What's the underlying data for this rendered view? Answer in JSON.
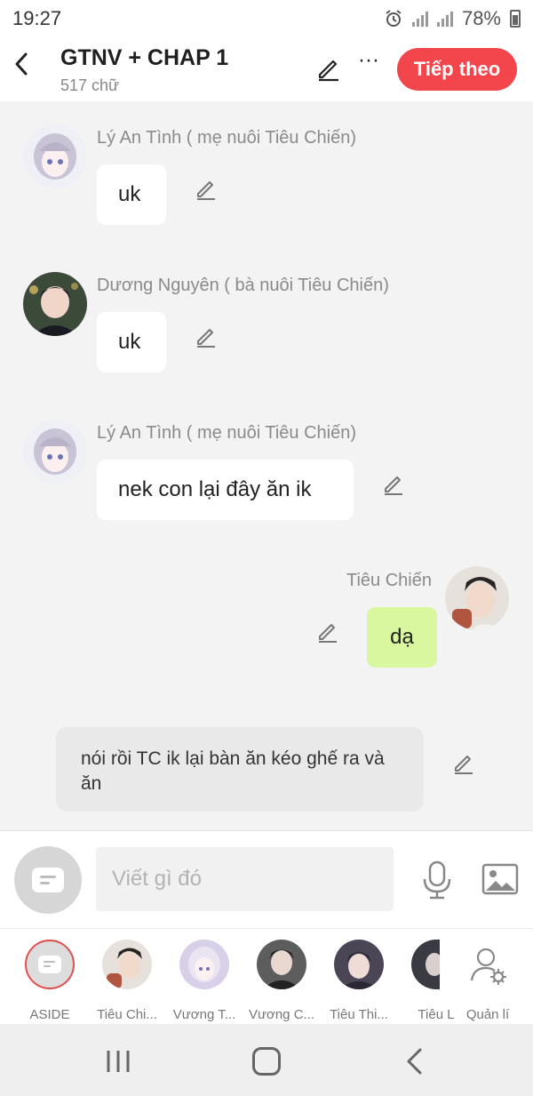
{
  "status_bar": {
    "time": "19:27",
    "battery": "78%"
  },
  "header": {
    "title": "GTNV + CHAP 1",
    "subtitle": "517 chữ",
    "next_label": "Tiếp theo",
    "more_label": "···",
    "back_label": "‹"
  },
  "chat": {
    "messages": [
      {
        "sender": "Lý An Tình ( mẹ nuôi Tiêu Chiến)",
        "text": "uk"
      },
      {
        "sender": "Dương Nguyên ( bà nuôi Tiêu Chiến)",
        "text": "uk"
      },
      {
        "sender": "Lý An Tình ( mẹ nuôi Tiêu Chiến)",
        "text": "nek con lại đây ăn ik"
      },
      {
        "sender": "Tiêu Chiến",
        "text": "dạ"
      }
    ],
    "narration": "nói rồi TC ik lại bàn ăn kéo ghế ra và ăn"
  },
  "composer": {
    "placeholder": "Viết gì đó"
  },
  "characters": [
    {
      "name": "ASIDE"
    },
    {
      "name": "Tiêu Chi..."
    },
    {
      "name": "Vương T..."
    },
    {
      "name": "Vương C..."
    },
    {
      "name": "Tiêu Thi..."
    },
    {
      "name": "Tiêu L"
    },
    {
      "name": "Quản lí"
    }
  ],
  "colors": {
    "accent": "#f2464c",
    "own_bubble": "#d9f79f",
    "background": "#f3f3f3"
  }
}
